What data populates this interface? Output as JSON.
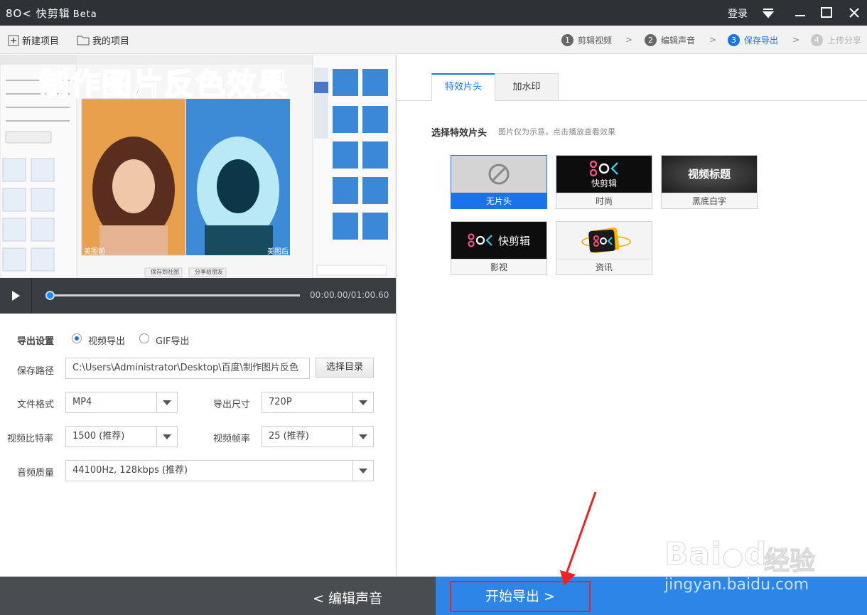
{
  "app": {
    "name": "快剪辑",
    "beta": "Beta",
    "login": "登录"
  },
  "toolbar": {
    "new_project": "新建项目",
    "my_projects": "我的项目"
  },
  "steps": [
    {
      "num": "1",
      "label": "剪辑视频",
      "state": "done"
    },
    {
      "num": "2",
      "label": "编辑声音",
      "state": "done"
    },
    {
      "num": "3",
      "label": "保存导出",
      "state": "active"
    },
    {
      "num": "4",
      "label": "上传分享",
      "state": "disabled"
    }
  ],
  "preview": {
    "title": "制作图片反色效果",
    "left_tag": "美图前",
    "right_tag": "美图后",
    "btn_save": "保存到社图",
    "btn_share": "分享给朋友"
  },
  "player": {
    "time": "00:00.00/01:00.60",
    "progress": 0.0
  },
  "settings": {
    "export_label": "导出设置",
    "radio_video": "视频导出",
    "radio_gif": "GIF导出",
    "path_label": "保存路径",
    "path_value": "C:\\Users\\Administrator\\Desktop\\百度\\制作图片反色",
    "choose_dir": "选择目录",
    "format_label": "文件格式",
    "format_value": "MP4",
    "size_label": "导出尺寸",
    "size_value": "720P",
    "bitrate_label": "视频比特率",
    "bitrate_value": "1500 (推荐)",
    "fps_label": "视频帧率",
    "fps_value": "25 (推荐)",
    "audio_label": "音频质量",
    "audio_value": "44100Hz, 128kbps (推荐)"
  },
  "tabs": [
    {
      "label": "特效片头",
      "active": true
    },
    {
      "label": "加水印",
      "active": false
    }
  ],
  "intro": {
    "title": "选择特效片头",
    "subtitle": "图片仅为示意，点击播放查看效果",
    "cards": [
      {
        "label": "无片头",
        "thumb_text": ""
      },
      {
        "label": "时尚",
        "thumb_text": "快剪辑"
      },
      {
        "label": "黑底白字",
        "thumb_text": "视频标题"
      },
      {
        "label": "影视",
        "thumb_text": "快剪辑"
      },
      {
        "label": "资讯",
        "thumb_text": ""
      }
    ]
  },
  "bottom": {
    "back": "编辑声音",
    "export": "开始导出"
  },
  "watermark": {
    "brand": "Bai",
    "brand2": "du",
    "cn": "经验",
    "url": "jingyan.baidu.com"
  },
  "colors": {
    "accent": "#1a73e8",
    "titlebar": "#2f3235",
    "export_bg": "#2c86e8",
    "highlight": "#e22222"
  }
}
